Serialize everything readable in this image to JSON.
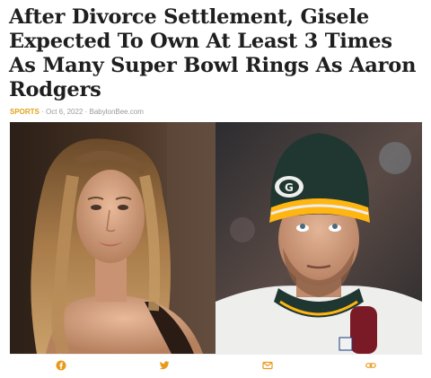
{
  "article": {
    "headline": "After Divorce Settlement, Gisele Expected To Own At Least 3 Times As Many Super Bowl Rings As Aaron Rodgers",
    "category": "SPORTS",
    "separator1": " · ",
    "date": "Oct 6, 2022",
    "separator2": " · ",
    "source": "BabylonBee.com"
  },
  "share_bar": {
    "items": [
      {
        "icon": "facebook-icon",
        "color": "#e89a1c"
      },
      {
        "icon": "twitter-icon",
        "color": "#e89a1c"
      },
      {
        "icon": "email-icon",
        "color": "#e89a1c"
      },
      {
        "icon": "link-icon",
        "color": "#e89a1c"
      }
    ]
  },
  "colors": {
    "accent": "#e0a21a",
    "headline": "#1f1f1f",
    "meta": "#9a9a9a",
    "packers_green": "#203731",
    "packers_gold": "#ffb612"
  }
}
